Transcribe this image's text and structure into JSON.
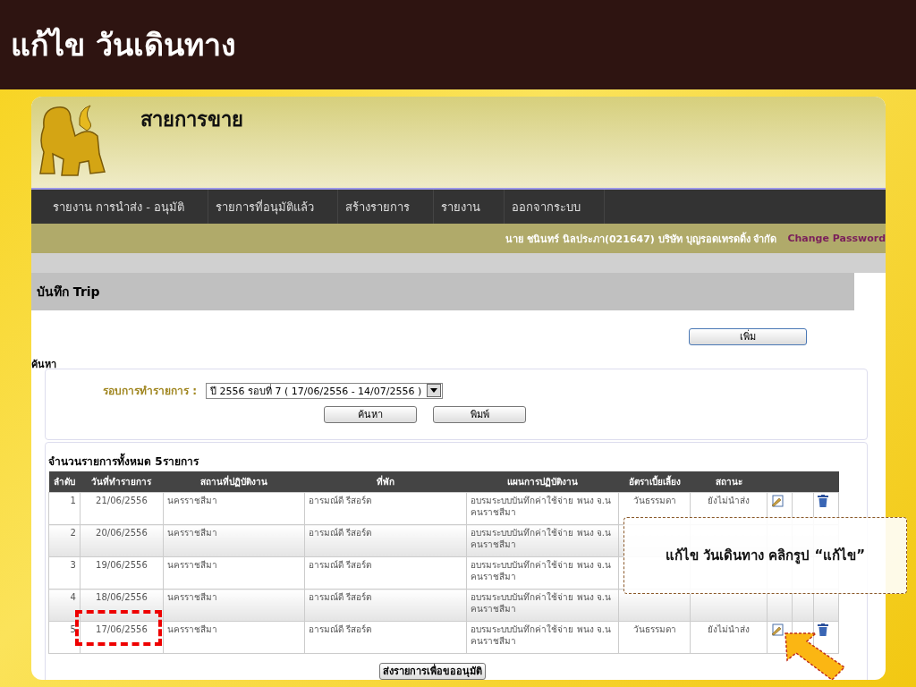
{
  "slide": {
    "title": "แก้ไข วันเดินทาง"
  },
  "app": {
    "title": "สายการขาย",
    "nav": [
      "รายงาน การนำส่ง - อนุมัติ",
      "รายการที่อนุมัติแล้ว",
      "สร้างรายการ",
      "รายงาน",
      "ออกจากระบบ"
    ],
    "user": "นาย ชนินทร์ นิลประภา(021647) บริษัท บุญรอดเทรดดิ้ง จำกัด",
    "change_password": "Change Password",
    "section_title": "บันทึก Trip",
    "add_button": "เพิ่ม",
    "search": {
      "legend": "ค้นหา",
      "label": "รอบการทำรายการ :",
      "value": "ปี 2556 รอบที่ 7 ( 17/06/2556 - 14/07/2556 )",
      "buttons": [
        "ค้นหา",
        "พิมพ์"
      ]
    },
    "table": {
      "summary": "จำนวนรายการทั้งหมด 5รายการ",
      "columns": [
        "ลำดับ",
        "วันที่ทำรายการ",
        "สถานที่ปฏิบัติงาน",
        "ที่พัก",
        "แผนการปฏิบัติงาน",
        "อัตราเบี้ยเลี้ยง",
        "สถานะ"
      ],
      "rows": [
        {
          "no": "1",
          "date": "21/06/2556",
          "place": "นครราชสีมา",
          "lodging": "อารมณ์ดี รีสอร์ต",
          "plan": "อบรมระบบบันทึกค่าใช้จ่าย พนง จ.นคนราชสีมา",
          "rate": "วันธรรมดา",
          "status": "ยังไม่นำส่ง",
          "highlighted": false
        },
        {
          "no": "2",
          "date": "20/06/2556",
          "place": "นครราชสีมา",
          "lodging": "อารมณ์ดี รีสอร์ต",
          "plan": "อบรมระบบบันทึกค่าใช้จ่าย พนง จ.นคนราชสีมา",
          "highlighted": false
        },
        {
          "no": "3",
          "date": "19/06/2556",
          "place": "นครราชสีมา",
          "lodging": "อารมณ์ดี รีสอร์ต",
          "plan": "อบรมระบบบันทึกค่าใช้จ่าย พนง จ.นคนราชสีมา",
          "highlighted": false
        },
        {
          "no": "4",
          "date": "18/06/2556",
          "place": "นครราชสีมา",
          "lodging": "อารมณ์ดี รีสอร์ต",
          "plan": "อบรมระบบบันทึกค่าใช้จ่าย พนง จ.นคนราชสีมา",
          "highlighted": false
        },
        {
          "no": "5",
          "date": "17/06/2556",
          "place": "นครราชสีมา",
          "lodging": "อารมณ์ดี รีสอร์ต",
          "plan": "อบรมระบบบันทึกค่าใช้จ่าย พนง จ.นคนราชสีมา",
          "rate": "วันธรรมดา",
          "status": "ยังไม่นำส่ง",
          "highlighted": true
        }
      ]
    },
    "submit_button": "ส่งรายการเพื่อขออนุมัติ"
  },
  "callout": {
    "text": "แก้ไข วันเดินทาง คลิกรูป “แก้ไข”"
  }
}
